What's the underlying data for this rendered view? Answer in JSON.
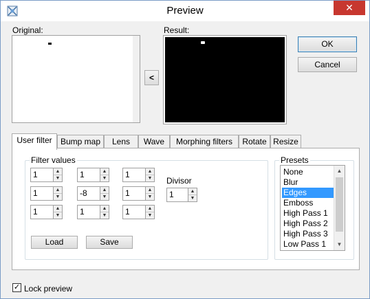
{
  "window": {
    "title": "Preview",
    "close_label": "✕"
  },
  "labels": {
    "original": "Original:",
    "result": "Result:"
  },
  "buttons": {
    "copy": "<",
    "ok": "OK",
    "cancel": "Cancel",
    "load": "Load",
    "save": "Save"
  },
  "tabs": [
    "User filter",
    "Bump map",
    "Lens",
    "Wave",
    "Morphing filters",
    "Rotate",
    "Resize"
  ],
  "active_tab": "User filter",
  "filter": {
    "group_title": "Filter values",
    "values": [
      [
        "1",
        "1",
        "1"
      ],
      [
        "1",
        "-8",
        "1"
      ],
      [
        "1",
        "1",
        "1"
      ]
    ],
    "divisor_label": "Divisor",
    "divisor": "1"
  },
  "presets": {
    "group_title": "Presets",
    "items": [
      "None",
      "Blur",
      "Edges",
      "Emboss",
      "High Pass 1",
      "High Pass 2",
      "High Pass 3",
      "Low Pass 1"
    ],
    "selected": "Edges"
  },
  "lock_preview": {
    "label": "Lock preview",
    "checked": true
  },
  "icons": {
    "app": "image-filter-icon",
    "close": "close-icon",
    "spin_up": "triangle-up-icon",
    "spin_down": "triangle-down-icon",
    "scroll_up": "chevron-up-icon",
    "scroll_down": "chevron-down-icon",
    "check": "checkmark-icon"
  },
  "colors": {
    "close_button": "#c7372f",
    "selection": "#3399ff",
    "result_bg": "#000000"
  }
}
